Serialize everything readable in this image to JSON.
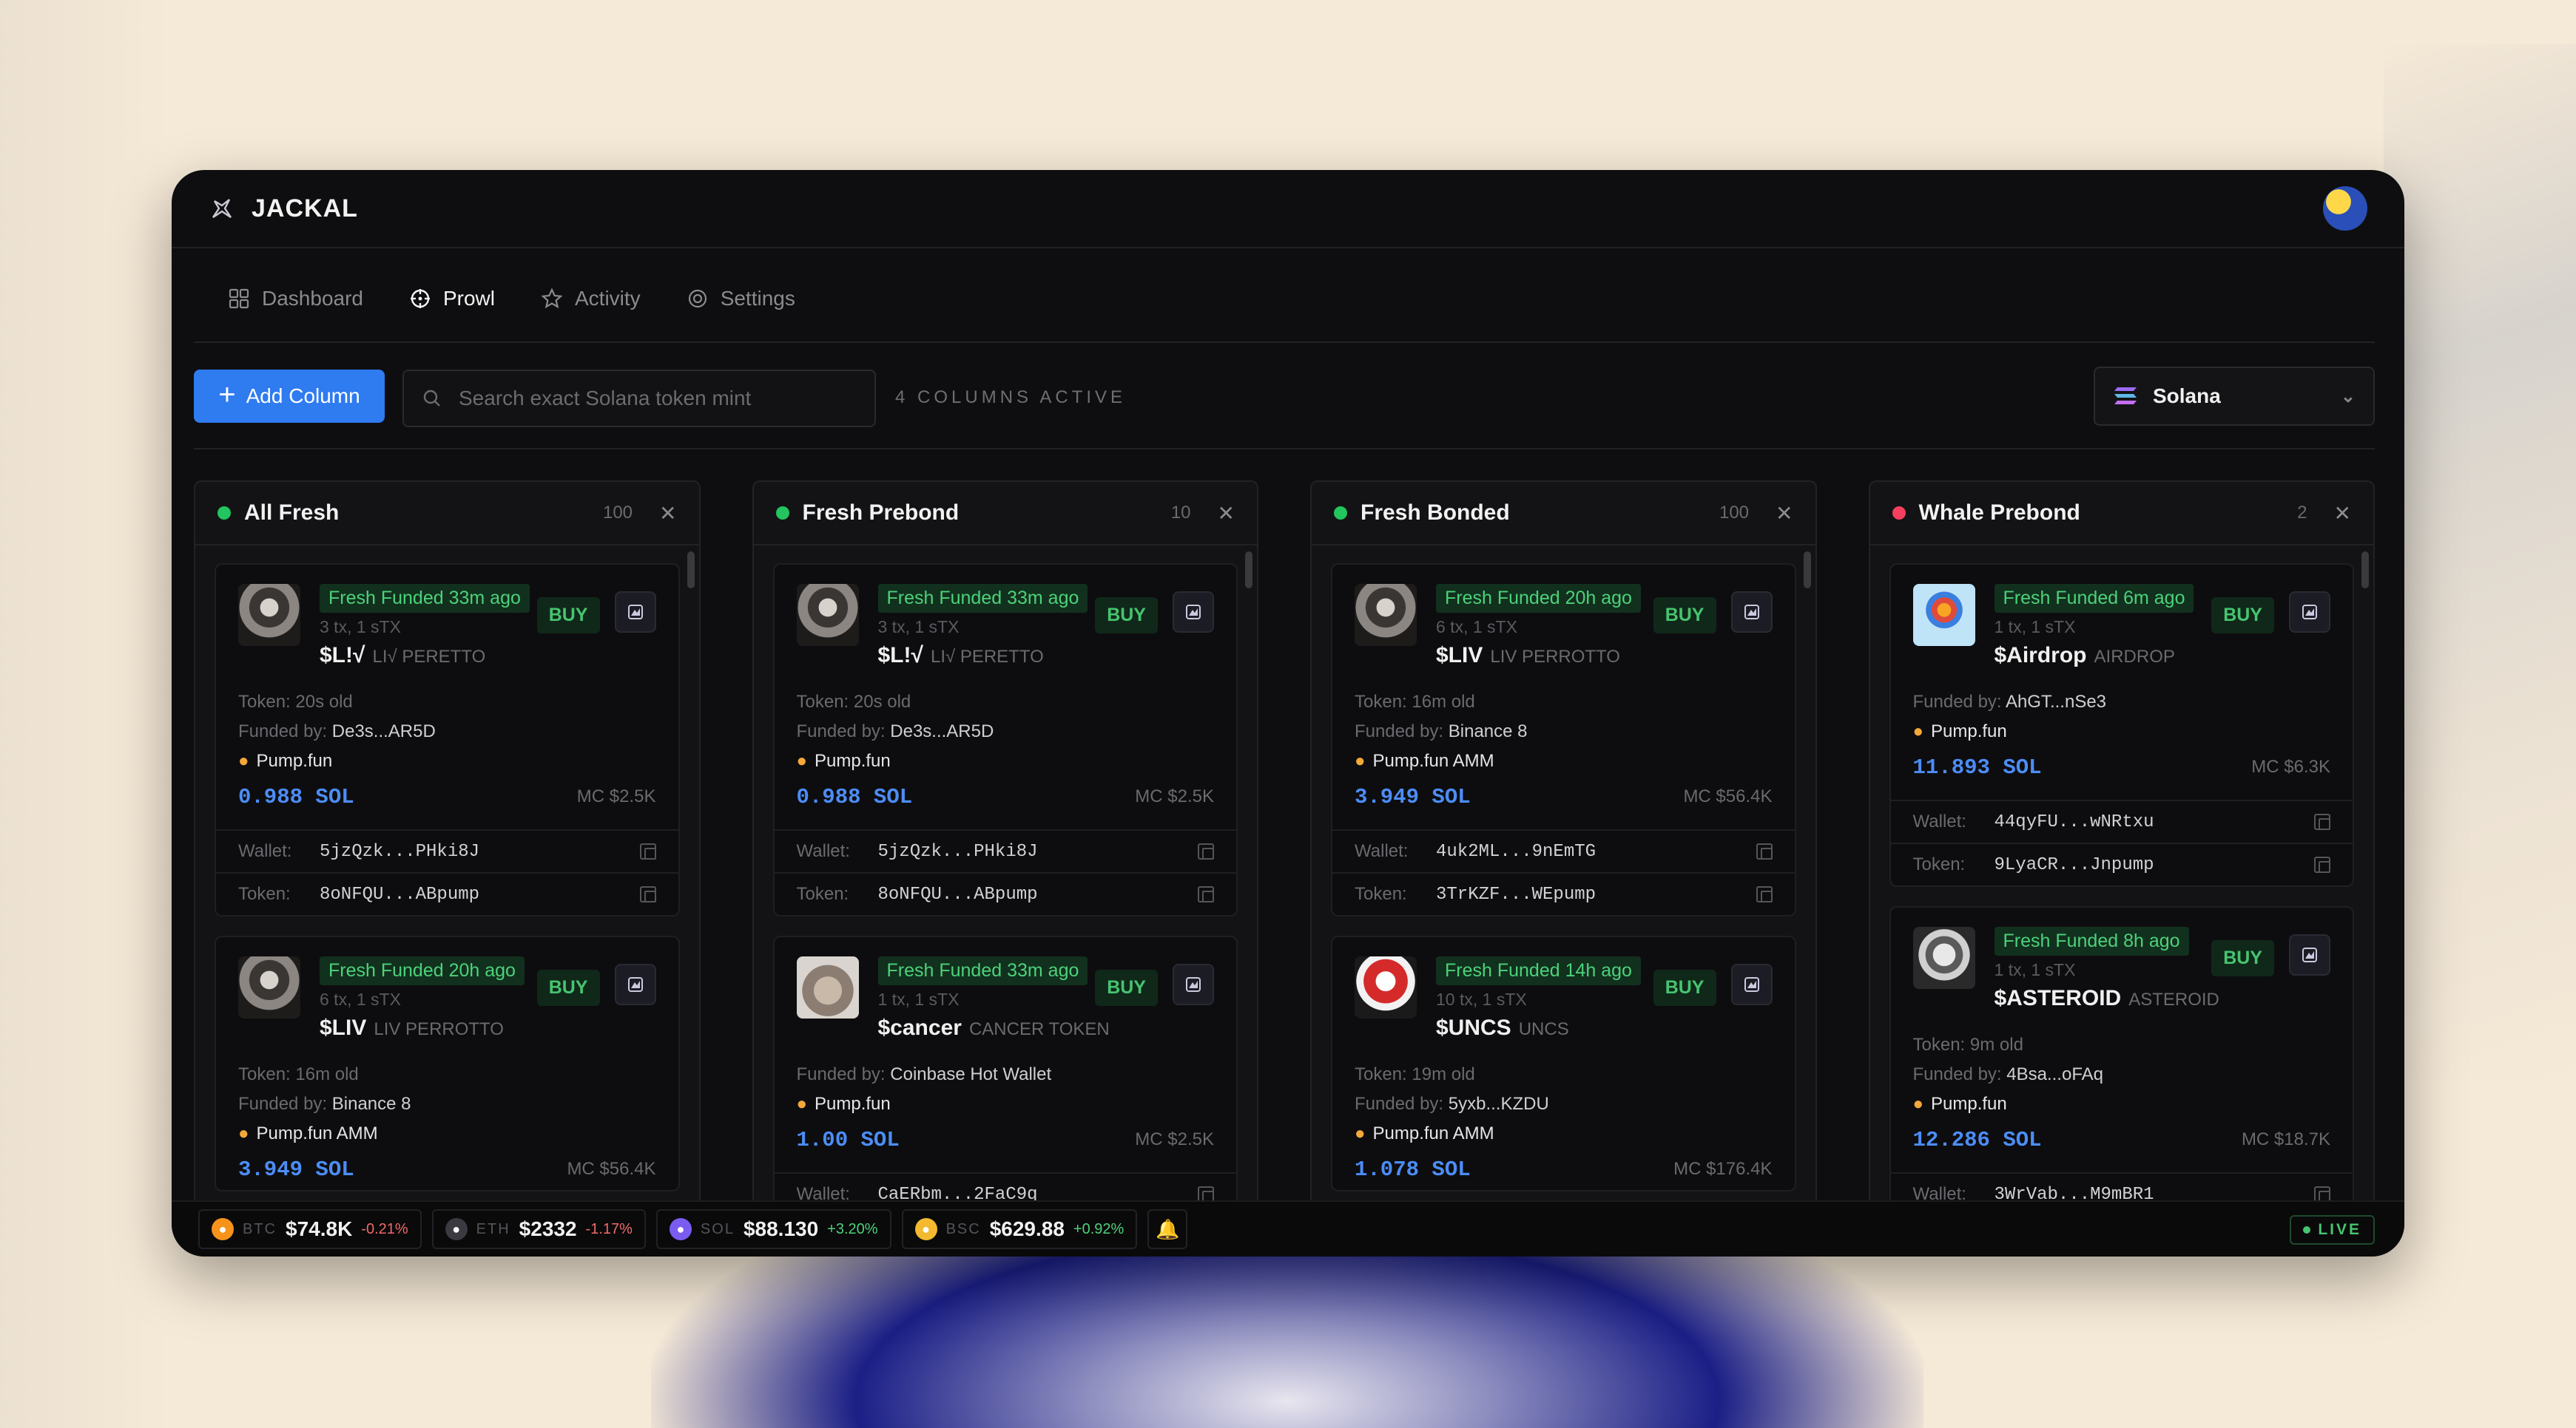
{
  "app": {
    "name": "JACKAL"
  },
  "nav": {
    "tabs": [
      {
        "label": "Dashboard"
      },
      {
        "label": "Prowl"
      },
      {
        "label": "Activity"
      },
      {
        "label": "Settings"
      }
    ]
  },
  "toolbar": {
    "add_label": "Add Column",
    "search_placeholder": "Search exact Solana token mint",
    "status": "4 COLUMNS ACTIVE",
    "chain": "Solana"
  },
  "columns": [
    {
      "title": "All Fresh",
      "count": "100",
      "dot_color": "#22c55e",
      "cards": [
        {
          "badge": "Fresh Funded 33m ago",
          "tx": "3 tx, 1 sTX",
          "symbol": "$L!√",
          "name": "LI√ PERETTO",
          "age": "20s old",
          "funded_by": "De3s...AR5D",
          "platform": "Pump.fun",
          "sol": "0.988 SOL",
          "mc": "MC $2.5K",
          "wallet": "5jzQzk...PHki8J",
          "token": "8oNFQU...ABpump",
          "avatar": "person"
        },
        {
          "badge": "Fresh Funded 20h ago",
          "tx": "6 tx, 1 sTX",
          "symbol": "$LIV",
          "name": "LIV PERROTTO",
          "age": "16m old",
          "funded_by": "Binance 8",
          "platform": "Pump.fun AMM",
          "sol": "3.949 SOL",
          "mc": "MC $56.4K",
          "avatar": "person"
        }
      ]
    },
    {
      "title": "Fresh Prebond",
      "count": "10",
      "dot_color": "#22c55e",
      "cards": [
        {
          "badge": "Fresh Funded 33m ago",
          "tx": "3 tx, 1 sTX",
          "symbol": "$L!√",
          "name": "LI√ PERETTO",
          "age": "20s old",
          "funded_by": "De3s...AR5D",
          "platform": "Pump.fun",
          "sol": "0.988 SOL",
          "mc": "MC $2.5K",
          "wallet": "5jzQzk...PHki8J",
          "token": "8oNFQU...ABpump",
          "avatar": "person"
        },
        {
          "badge": "Fresh Funded 33m ago",
          "tx": "1 tx, 1 sTX",
          "symbol": "$cancer",
          "name": "CANCER TOKEN",
          "funded_by": "Coinbase Hot Wallet",
          "platform": "Pump.fun",
          "sol": "1.00 SOL",
          "mc": "MC $2.5K",
          "wallet": "CaERbm...2FaC9q",
          "avatar": "crab"
        }
      ]
    },
    {
      "title": "Fresh Bonded",
      "count": "100",
      "dot_color": "#22c55e",
      "cards": [
        {
          "badge": "Fresh Funded 20h ago",
          "tx": "6 tx, 1 sTX",
          "symbol": "$LIV",
          "name": "LIV PERROTTO",
          "age": "16m old",
          "funded_by": "Binance 8",
          "platform": "Pump.fun AMM",
          "sol": "3.949 SOL",
          "mc": "MC $56.4K",
          "wallet": "4uk2ML...9nEmTG",
          "token": "3TrKZF...WEpump",
          "avatar": "person"
        },
        {
          "badge": "Fresh Funded 14h ago",
          "tx": "10 tx, 1 sTX",
          "symbol": "$UNCS",
          "name": "UNCS",
          "age": "19m old",
          "funded_by": "5yxb...KZDU",
          "platform": "Pump.fun AMM",
          "sol": "1.078 SOL",
          "mc": "MC $176.4K",
          "avatar": "santa"
        }
      ]
    },
    {
      "title": "Whale Prebond",
      "count": "2",
      "dot_color": "#f43f5e",
      "cards": [
        {
          "badge": "Fresh Funded 6m ago",
          "tx": "1 tx, 1 sTX",
          "symbol": "$Airdrop",
          "name": "AIRDROP",
          "funded_by": "AhGT...nSe3",
          "platform": "Pump.fun",
          "sol": "11.893 SOL",
          "mc": "MC $6.3K",
          "wallet": "44qyFU...wNRtxu",
          "token": "9LyaCR...Jnpump",
          "avatar": "balloon"
        },
        {
          "badge": "Fresh Funded 8h ago",
          "tx": "1 tx, 1 sTX",
          "symbol": "$ASTEROID",
          "name": "ASTEROID",
          "age": "9m old",
          "funded_by": "4Bsa...oFAq",
          "platform": "Pump.fun",
          "sol": "12.286 SOL",
          "mc": "MC $18.7K",
          "wallet": "3WrVab...M9mBR1",
          "avatar": "astro"
        }
      ]
    }
  ],
  "labels": {
    "token_age": "Token:",
    "funded_by": "Funded by:",
    "wallet": "Wallet:",
    "token": "Token:",
    "buy": "BUY"
  },
  "ticker": [
    {
      "sym": "BTC",
      "price": "$74.8K",
      "change": "-0.21%",
      "color": "#f7931a"
    },
    {
      "sym": "ETH",
      "price": "$2332",
      "change": "-1.17%",
      "color": "#3a3a40"
    },
    {
      "sym": "SOL",
      "price": "$88.130",
      "change": "+3.20%",
      "color": "#7b5cf0"
    },
    {
      "sym": "BSC",
      "price": "$629.88",
      "change": "+0.92%",
      "color": "#f3ba2f"
    }
  ],
  "live_label": "LIVE"
}
